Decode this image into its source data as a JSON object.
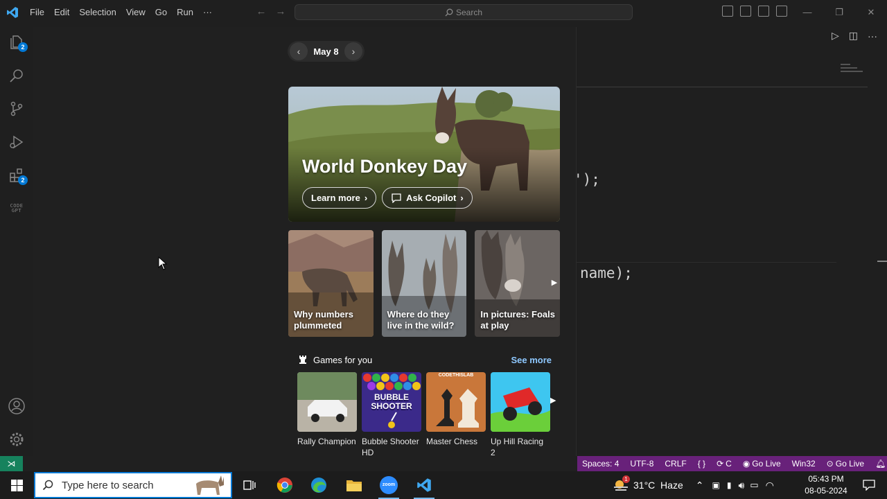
{
  "titlebar": {
    "menus": [
      "File",
      "Edit",
      "Selection",
      "View",
      "Go",
      "Run",
      "···"
    ],
    "search_placeholder": "Search"
  },
  "activitybar": {
    "explorer_badge": "2",
    "extensions_badge": "2",
    "codegpt_label_1": "CODE",
    "codegpt_label_2": "GPT"
  },
  "editor": {
    "code_line_1": "');",
    "code_line_2": "name);"
  },
  "flyout": {
    "date": "May 8",
    "hero": {
      "title": "World Donkey Day",
      "learn_more": "Learn more",
      "ask_copilot": "Ask Copilot"
    },
    "cards": [
      {
        "caption": "Why numbers plummeted"
      },
      {
        "caption": "Where do they live in the wild?"
      },
      {
        "caption": "In pictures: Foals at play"
      }
    ],
    "games": {
      "title": "Games for you",
      "see_more": "See more",
      "items": [
        {
          "name": "Rally Champion"
        },
        {
          "name": "Bubble Shooter HD",
          "thumb_text": "BUBBLE SHOOTER"
        },
        {
          "name": "Master Chess",
          "thumb_text": "CODETHISLAB"
        },
        {
          "name": "Up Hill Racing 2"
        }
      ]
    }
  },
  "statusbar": {
    "spaces": "Spaces: 4",
    "encoding": "UTF-8",
    "eol": "CRLF",
    "lang": "{ }",
    "c": "C",
    "golive1": "Go Live",
    "platform": "Win32",
    "golive2": "Go Live"
  },
  "taskbar": {
    "search_placeholder": "Type here to search",
    "weather": "31°C  Haze",
    "weather_badge": "1",
    "time": "05:43 PM",
    "date": "08-05-2024",
    "zoom_label": "zoom"
  },
  "colors": {
    "accent_blue": "#0078d4",
    "statusbar_purple": "#68217a",
    "remote_green": "#16825d",
    "link_blue": "#8ec8ff"
  }
}
